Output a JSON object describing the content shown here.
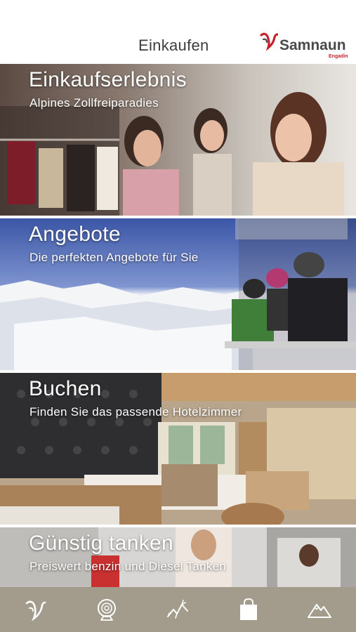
{
  "header": {
    "title": "Einkaufen",
    "logo": {
      "name": "Samnaun",
      "sub": "Engadin",
      "brand_color": "#c4222f"
    }
  },
  "tiles": [
    {
      "title": "Einkaufserlebnis",
      "subtitle": "Alpines Zollfreiparadies"
    },
    {
      "title": "Angebote",
      "subtitle": "Die perfekten Angebote für Sie"
    },
    {
      "title": "Buchen",
      "subtitle": "Finden Sie das passende Hotelzimmer"
    },
    {
      "title": "Günstig tanken",
      "subtitle": "Preiswert benzin und Diesel Tanken"
    }
  ],
  "tab_bar": {
    "background": "#a39c8d",
    "tabs": [
      {
        "icon": "samnaun-logo-icon",
        "active": false
      },
      {
        "icon": "webcam-icon",
        "active": false
      },
      {
        "icon": "activity-icon",
        "active": false
      },
      {
        "icon": "shopping-bag-icon",
        "active": true
      },
      {
        "icon": "mountain-icon",
        "active": false
      }
    ]
  }
}
